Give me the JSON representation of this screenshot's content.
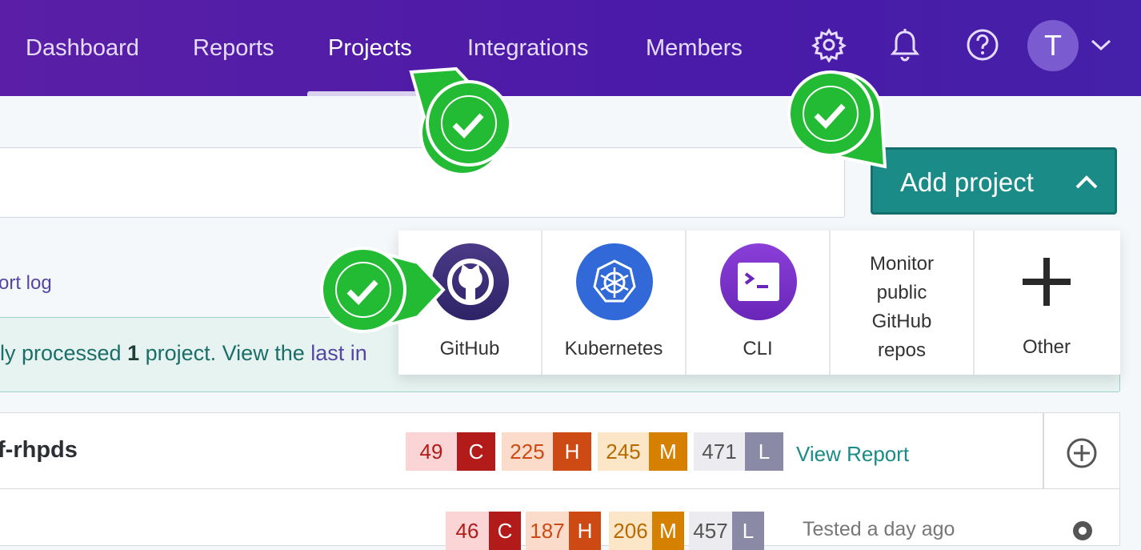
{
  "nav": {
    "items": [
      {
        "label": "Dashboard"
      },
      {
        "label": "Reports"
      },
      {
        "label": "Projects"
      },
      {
        "label": "Integrations"
      },
      {
        "label": "Members"
      }
    ],
    "active": "Projects",
    "avatar_initial": "T",
    "icons": [
      "gear-icon",
      "bell-icon",
      "help-icon",
      "chevron-down-icon"
    ]
  },
  "toolbar": {
    "add_project_label": "Add project"
  },
  "import_log": {
    "link_text": "ort log"
  },
  "banner": {
    "prefix": "ly processed ",
    "count": "1",
    "middle": " project. View the ",
    "link_text": "last in"
  },
  "dropdown": {
    "items": [
      {
        "label": "GitHub",
        "icon": "github-icon"
      },
      {
        "label": "Kubernetes",
        "icon": "kubernetes-icon"
      },
      {
        "label": "CLI",
        "icon": "terminal-icon"
      },
      {
        "label": "Monitor public GitHub repos",
        "lines": [
          "Monitor",
          "public",
          "GitHub",
          "repos"
        ]
      },
      {
        "label": "Other",
        "icon": "plus-icon"
      }
    ]
  },
  "projects": [
    {
      "name": "f-rhpds",
      "critical": "49",
      "critical_letter": "C",
      "high": "225",
      "high_letter": "H",
      "medium": "245",
      "medium_letter": "M",
      "low": "471",
      "low_letter": "L",
      "action": "View Report"
    },
    {
      "name": "",
      "critical": "46",
      "critical_letter": "C",
      "high": "187",
      "high_letter": "H",
      "medium": "206",
      "medium_letter": "M",
      "low": "457",
      "low_letter": "L",
      "status": "Tested a day ago"
    }
  ],
  "colors": {
    "nav_bg": "#4a1aa8",
    "accent_teal": "#1a8b87",
    "critical": "#b31b1b",
    "high": "#ce4a14",
    "medium": "#d68000",
    "low": "#8b8aa6",
    "check_green": "#22bb33"
  }
}
